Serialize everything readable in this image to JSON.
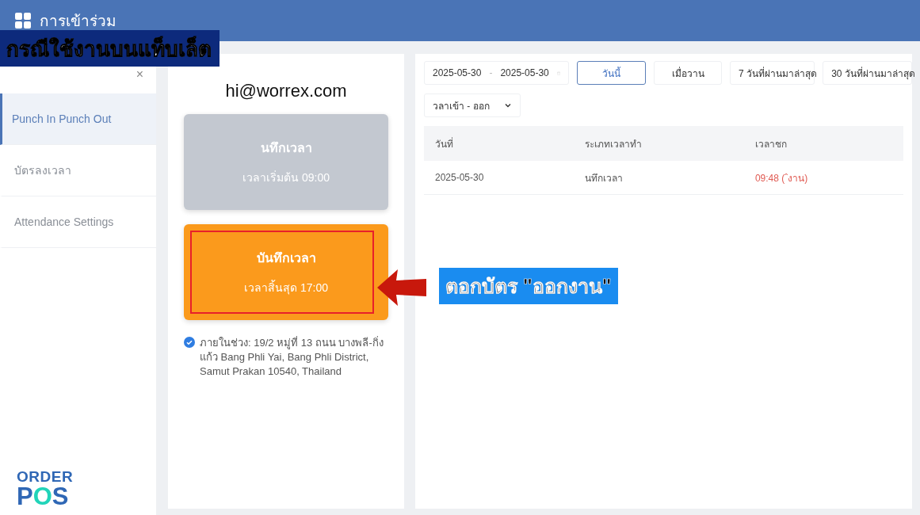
{
  "header": {
    "title": "การเข้าร่วม"
  },
  "caption": {
    "text": "กรณีใช้งานบนแท็บเล็ต"
  },
  "sidebar": {
    "close": "×",
    "items": [
      {
        "label": "Punch In Punch Out",
        "selected": true
      },
      {
        "label": "บัตรลงเวลา",
        "selected": false
      },
      {
        "label": "Attendance Settings",
        "selected": false
      }
    ],
    "logo": {
      "top": "ORDER",
      "bottom_start": "P",
      "bottom_accent": "O",
      "bottom_end": "S"
    }
  },
  "punch": {
    "email": "hi@worrex.com",
    "buttons": [
      {
        "title": "นทึกเวลา",
        "subtitle": "เวลาเริ่มต้น 09:00",
        "disabled": true,
        "highlighted": false
      },
      {
        "title": "บันทึกเวลา",
        "subtitle": "เวลาสิ้นสุด 17:00",
        "disabled": false,
        "highlighted": true
      }
    ],
    "location": {
      "verified": true,
      "text": "ภายในช่วง: 19/2 หมู่ที่ 13 ถนน บางพลี-กิ่งแก้ว Bang Phli Yai, Bang Phli District, Samut Prakan 10540, Thailand"
    }
  },
  "callout": {
    "text": "ตอกบัตร \"ออกงาน\""
  },
  "records": {
    "date_from": "2025-05-30",
    "date_separator": "-",
    "date_to": "2025-05-30",
    "quick_ranges": [
      {
        "label": "วันนี้",
        "selected": true
      },
      {
        "label": "เมื่อวาน",
        "selected": false
      },
      {
        "label": "7 วันที่ผ่านมาล่าสุด",
        "selected": false
      },
      {
        "label": "30 วันที่ผ่านมาล่าสุด",
        "selected": false
      }
    ],
    "filter": "วลาเข้า - ออก",
    "table": {
      "columns": [
        "วันที่",
        "ระเภทเวลาทำ",
        "เวลาชก"
      ],
      "rows": [
        {
          "date": "2025-05-30",
          "type": "นทึกเวลา",
          "time": "09:48 (ˆงาน)",
          "late": true
        }
      ]
    }
  }
}
